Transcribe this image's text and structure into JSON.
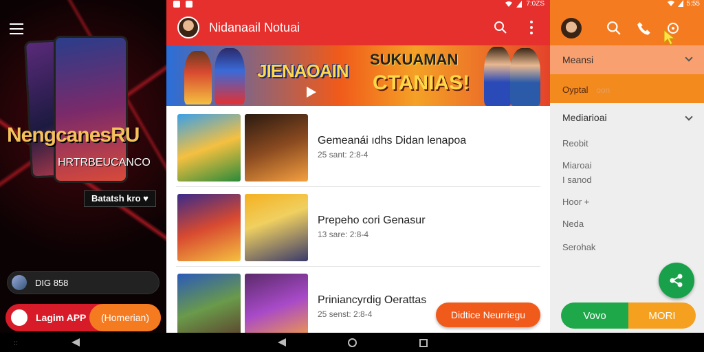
{
  "left_panel": {
    "promo_title": "NengcanesRU",
    "promo_subtitle": "HRTRBEUCANCO",
    "promo_chip": "Batatsh kro ♥",
    "pill_text": "DIG 858",
    "install_label": "Lagim APP",
    "install_secondary": "(Homerian)"
  },
  "status_bar": {
    "time_mid": "7:0ZS",
    "time_right": "5:55"
  },
  "app_bar": {
    "title": "Nidanaail Notuai"
  },
  "banner": {
    "text_left": "JIENAOAIN",
    "text_right_top": "SUKUAMAN",
    "text_right_main": "CTANIAS!"
  },
  "list": {
    "items": [
      {
        "title": "Gemeanái ıdhs Didan lenapoa",
        "subtitle": "25 sant: 2:8-4"
      },
      {
        "title": "Prepeho cori Genasur",
        "subtitle": "13 sare: 2:8-4"
      },
      {
        "title": "Priniancyrdig Oerattas",
        "subtitle": "25 senst: 2:8-4"
      }
    ]
  },
  "fab_wide": {
    "label": "Didtice Neurriegu"
  },
  "right_panel": {
    "header1": "Meansi",
    "header2": "Oyptal",
    "header2_hint": "oon",
    "header3": "Mediarioai",
    "items": [
      "Reobit",
      "Miaroai",
      "I sanod",
      "Hoor +",
      "Neda",
      "Serohak"
    ],
    "btn_left": "Vovo",
    "btn_right": "MORI"
  },
  "colors": {
    "accent_red": "#e5302e",
    "accent_orange": "#f57b20",
    "accent_green": "#18a04a"
  }
}
